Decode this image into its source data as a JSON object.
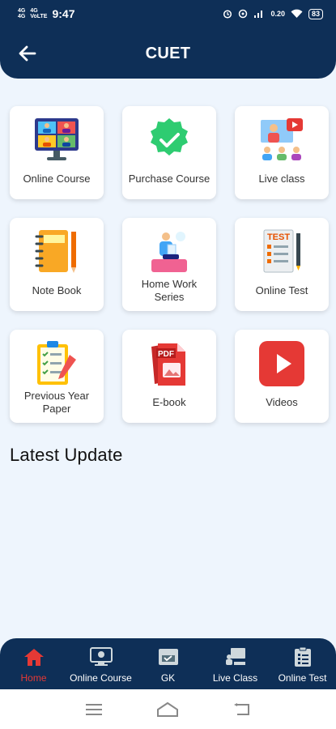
{
  "status_bar": {
    "time": "9:47",
    "net_top": "4G",
    "net_bottom": "4G",
    "vo_top": "4G",
    "vo_bottom": "VoLTE",
    "speed": "0.20",
    "battery": "83"
  },
  "header": {
    "title": "CUET"
  },
  "grid": [
    {
      "label": "Online Course",
      "icon": "video-conference-icon"
    },
    {
      "label": "Purchase Course",
      "icon": "verified-badge-icon"
    },
    {
      "label": "Live class",
      "icon": "live-class-icon"
    },
    {
      "label": "Note Book",
      "icon": "notebook-icon"
    },
    {
      "label": "Home Work Series",
      "icon": "homework-study-icon"
    },
    {
      "label": "Online Test",
      "icon": "test-sheet-icon"
    },
    {
      "label": "Previous Year Paper",
      "icon": "clipboard-checklist-icon"
    },
    {
      "label": "E-book",
      "icon": "pdf-file-icon"
    },
    {
      "label": "Videos",
      "icon": "play-video-icon"
    }
  ],
  "icon_text": {
    "test": "TEST",
    "pdf": "PDF"
  },
  "latest": {
    "title": "Latest Update"
  },
  "bottom_nav": [
    {
      "label": "Home",
      "icon": "home-icon",
      "active": true
    },
    {
      "label": "Online Course",
      "icon": "monitor-course-icon",
      "active": false
    },
    {
      "label": "GK",
      "icon": "gk-book-icon",
      "active": false
    },
    {
      "label": "Live Class",
      "icon": "live-class-tab-icon",
      "active": false
    },
    {
      "label": "Online Test",
      "icon": "test-clipboard-icon",
      "active": false
    }
  ],
  "colors": {
    "primary": "#0e2f57",
    "background": "#eef5fd",
    "active_tab": "#e53935"
  }
}
